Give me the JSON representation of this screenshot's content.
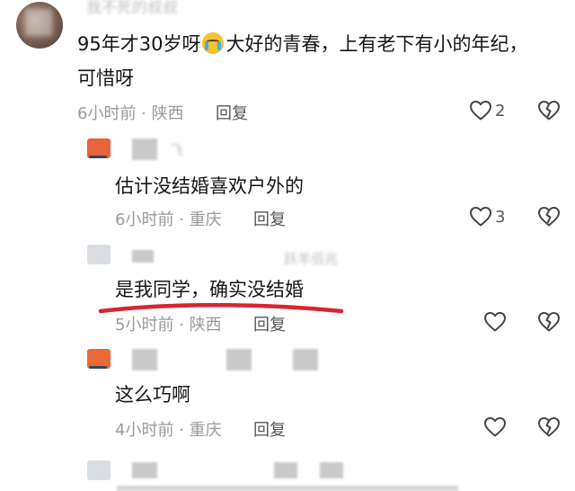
{
  "comments": [
    {
      "author_blurred": "我不死的叔叔",
      "text_line1_before": "95年才30岁呀",
      "text_line1_after": "大好的青春，上有老下有小的年纪，",
      "emoji": "crying-face-emoji",
      "text_line2": "可惜呀",
      "time": "6小时前",
      "location": "陕西",
      "reply_label": "回复",
      "like_count": "2"
    },
    {
      "author_blurred": "飞",
      "text": "估计没结婚喜欢户外的",
      "time": "6小时前",
      "location": "重庆",
      "reply_label": "回复",
      "like_count": "3",
      "avatar_color": "#e8633a"
    },
    {
      "author_blurred": "跃羊佰兆",
      "text": "是我同学，确实没结婚",
      "time": "5小时前",
      "location": "陕西",
      "reply_label": "回复",
      "underline_color": "#d8262e"
    },
    {
      "text": "这么巧啊",
      "time": "4小时前",
      "location": "重庆",
      "reply_label": "回复",
      "avatar_color": "#ea6a37"
    }
  ],
  "separator": " · ",
  "icons": [
    "heart-icon",
    "broken-heart-icon"
  ]
}
